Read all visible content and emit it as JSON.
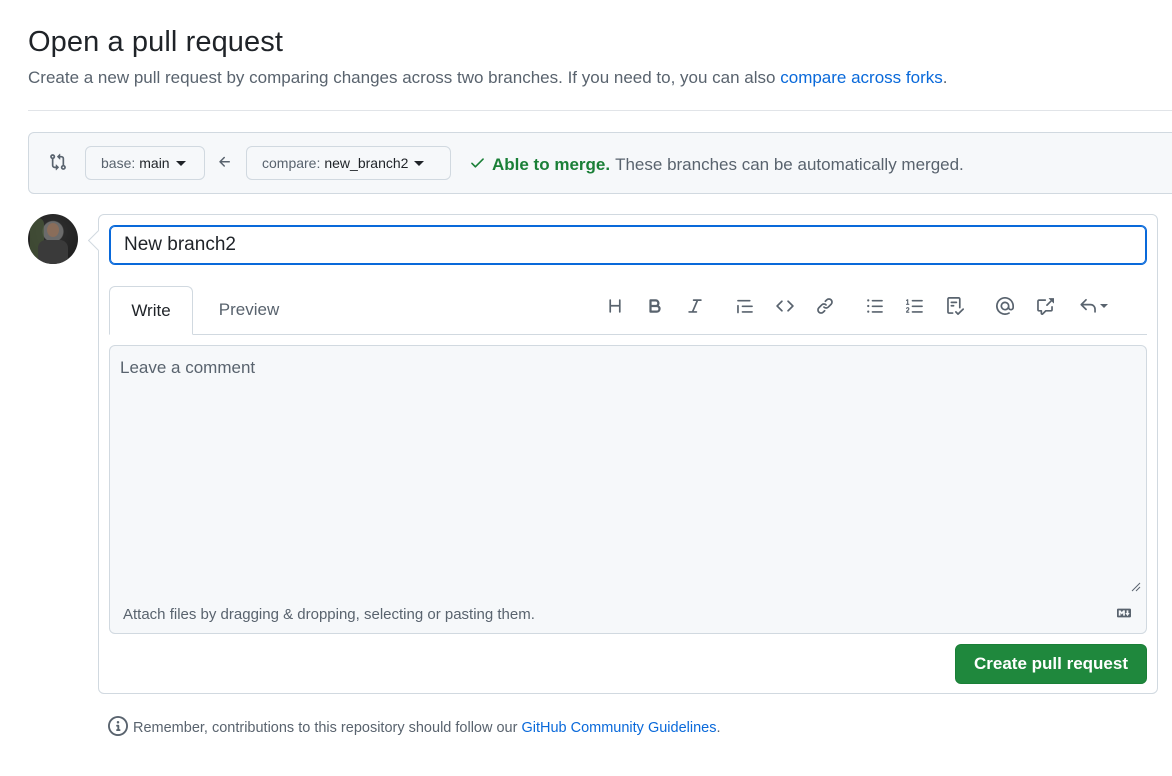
{
  "header": {
    "title": "Open a pull request",
    "subtitle": "Create a new pull request by comparing changes across two branches. If you need to, you can also",
    "subtitle_link": "compare across forks",
    "subtitle_end": "."
  },
  "range": {
    "base_label": "base:",
    "base_value": "main",
    "compare_label": "compare:",
    "compare_value": "new_branch2",
    "merge_status": "Able to merge.",
    "merge_message": "These branches can be automatically merged."
  },
  "form": {
    "title_value": "New branch2",
    "tabs": [
      {
        "label": "Write"
      },
      {
        "label": "Preview"
      }
    ],
    "toolbar_icons": [
      "heading-icon",
      "bold-icon",
      "italic-icon",
      "quote-icon",
      "code-icon",
      "link-icon",
      "bulleted-list-icon",
      "numbered-list-icon",
      "task-list-icon",
      "mention-icon",
      "cross-reference-icon",
      "saved-replies-icon"
    ],
    "comment_placeholder": "Leave a comment",
    "attach_text": "Attach files by dragging & dropping, selecting or pasting them.",
    "submit_label": "Create pull request"
  },
  "footer": {
    "note": "Remember, contributions to this repository should follow our",
    "link": "GitHub Community Guidelines",
    "end": "."
  },
  "colors": {
    "accent": "#0969da",
    "success": "#1a7f37",
    "button_green": "#1f883d"
  }
}
